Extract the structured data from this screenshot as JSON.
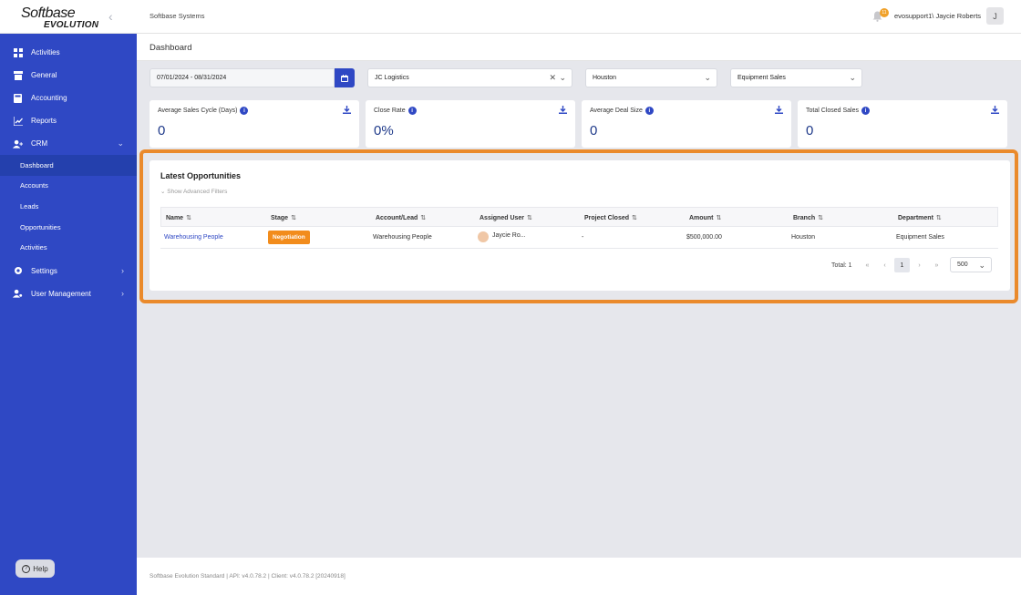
{
  "logo": {
    "top": "Softbase",
    "bottom": "EVOLUTION"
  },
  "sidebar": {
    "items": [
      {
        "label": "Activities",
        "icon": "grid-icon"
      },
      {
        "label": "General",
        "icon": "archive-icon"
      },
      {
        "label": "Accounting",
        "icon": "calculator-icon"
      },
      {
        "label": "Reports",
        "icon": "chart-icon"
      },
      {
        "label": "CRM",
        "icon": "users-icon"
      }
    ],
    "crm_sub": [
      {
        "label": "Dashboard"
      },
      {
        "label": "Accounts"
      },
      {
        "label": "Leads"
      },
      {
        "label": "Opportunities"
      },
      {
        "label": "Activities"
      }
    ],
    "settings": "Settings",
    "user_mgmt": "User Management",
    "help": "Help"
  },
  "topbar": {
    "company": "Softbase Systems",
    "notification_count": "11",
    "user": "evosupport1\\ Jaycie Roberts",
    "avatar_initial": "J"
  },
  "page": {
    "title": "Dashboard"
  },
  "filters": {
    "date_range": "07/01/2024 - 08/31/2024",
    "account": "JC Logistics",
    "branch": "Houston",
    "department": "Equipment Sales"
  },
  "kpis": [
    {
      "label": "Average Sales Cycle (Days)",
      "value": "0"
    },
    {
      "label": "Close Rate",
      "value": "0%"
    },
    {
      "label": "Average Deal Size",
      "value": "0"
    },
    {
      "label": "Total Closed Sales",
      "value": "0"
    }
  ],
  "opportunities": {
    "title": "Latest Opportunities",
    "advanced_filters": "Show Advanced Filters",
    "columns": [
      "Name",
      "Stage",
      "Account/Lead",
      "Assigned User",
      "Project Closed",
      "Amount",
      "Branch",
      "Department"
    ],
    "rows": [
      {
        "name": "Warehousing People",
        "stage": "Negotiation",
        "account": "Warehousing People",
        "user": "Jaycie Ro...",
        "project_closed": "-",
        "amount": "$500,000.00",
        "branch": "Houston",
        "department": "Equipment Sales"
      }
    ],
    "pager": {
      "total": "Total: 1",
      "current_page": "1",
      "page_size": "500"
    }
  },
  "footer": "Softbase Evolution Standard | API: v4.0.78.2 | Client: v4.0.78.2 [20240918]",
  "colors": {
    "primary": "#2f48c4",
    "accent": "#ea8a2c",
    "badge": "#f28c1c"
  }
}
